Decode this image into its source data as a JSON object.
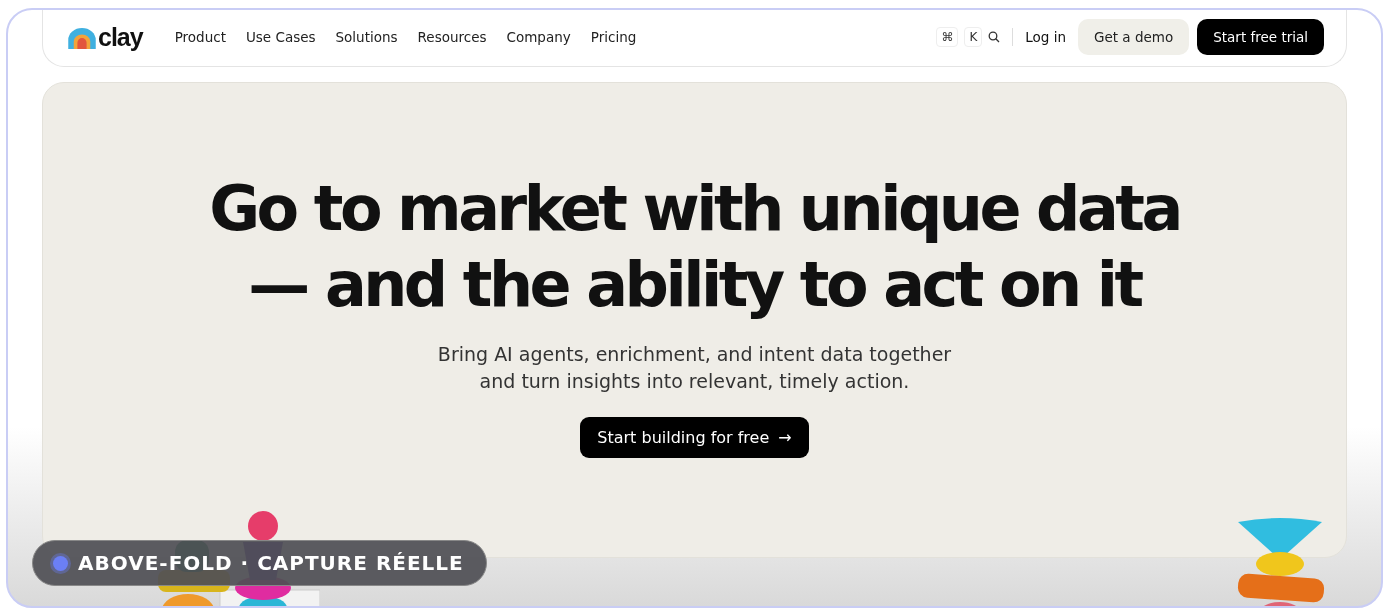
{
  "nav": {
    "logo": "clay",
    "links": [
      {
        "label": "Product"
      },
      {
        "label": "Use Cases"
      },
      {
        "label": "Solutions"
      },
      {
        "label": "Resources"
      },
      {
        "label": "Company"
      },
      {
        "label": "Pricing"
      }
    ],
    "shortcut_keys": [
      "⌘",
      "K"
    ],
    "login": "Log in",
    "demo_button": "Get a demo",
    "trial_button": "Start free trial"
  },
  "hero": {
    "headline_lines": [
      "Go to market with unique data",
      "— and the ability to act on it"
    ],
    "subtitle_lines": [
      "Bring AI agents, enrichment, and intent data together",
      "and turn insights into relevant, timely action."
    ],
    "cta": "Start building for free",
    "cta_arrow": "→"
  },
  "overlay_badge": {
    "label": "ABOVE-FOLD · CAPTURE RÉELLE",
    "color": "#6b7ff5"
  }
}
